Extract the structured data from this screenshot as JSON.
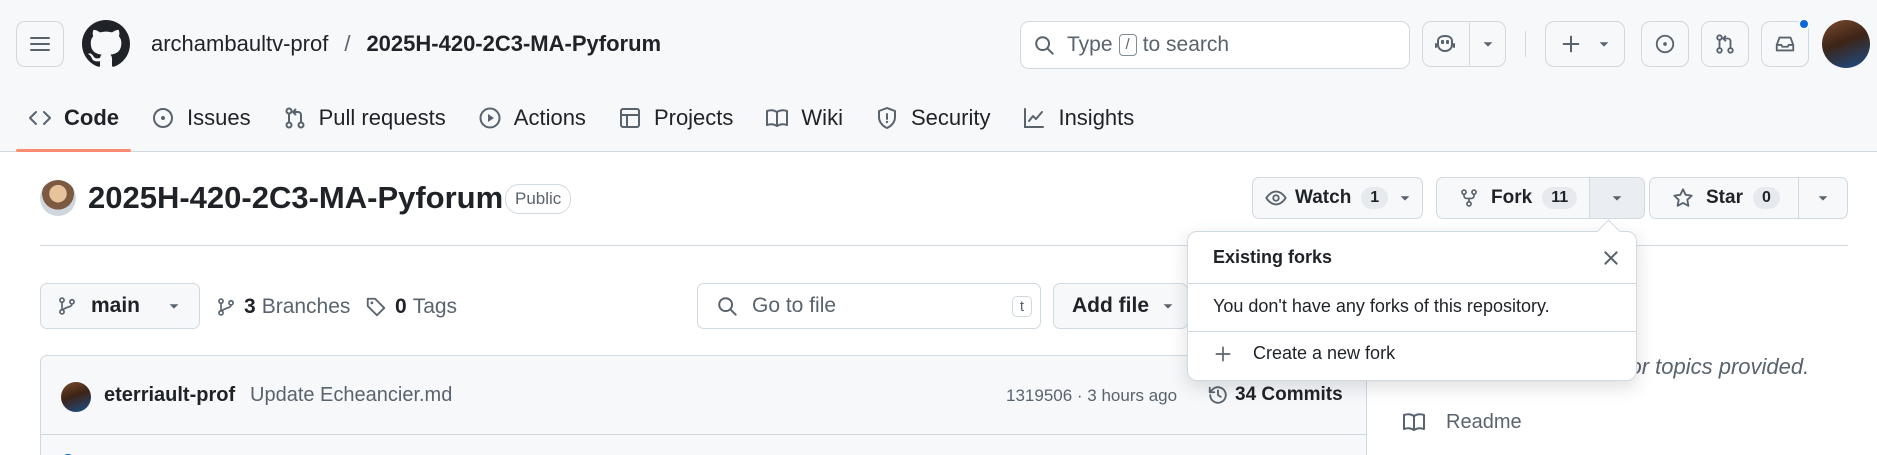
{
  "header": {
    "owner": "archambaultv-prof",
    "separator": "/",
    "repo": "2025H-420-2C3-MA-Pyforum",
    "search": {
      "prefix": "Type",
      "key": "/",
      "suffix": "to search"
    }
  },
  "tabs": [
    {
      "label": "Code",
      "icon": "code-icon",
      "active": true
    },
    {
      "label": "Issues",
      "icon": "issue-icon"
    },
    {
      "label": "Pull requests",
      "icon": "pull-request-icon"
    },
    {
      "label": "Actions",
      "icon": "play-icon"
    },
    {
      "label": "Projects",
      "icon": "table-icon"
    },
    {
      "label": "Wiki",
      "icon": "book-icon"
    },
    {
      "label": "Security",
      "icon": "shield-icon"
    },
    {
      "label": "Insights",
      "icon": "graph-icon"
    }
  ],
  "repo_head": {
    "title": "2025H-420-2C3-MA-Pyforum",
    "visibility": "Public",
    "watch": {
      "label": "Watch",
      "count": "1"
    },
    "fork": {
      "label": "Fork",
      "count": "11"
    },
    "star": {
      "label": "Star",
      "count": "0"
    }
  },
  "file_nav": {
    "branch": "main",
    "branches": {
      "count": "3",
      "label": "Branches"
    },
    "tags": {
      "count": "0",
      "label": "Tags"
    },
    "goto_placeholder": "Go to file",
    "goto_key": "t",
    "add_file": "Add file"
  },
  "latest_commit": {
    "author": "eterriault-prof",
    "message": "Update Echeancier.md",
    "sha_time": "1319506 · 3 hours ago",
    "commits": "34 Commits"
  },
  "about": {
    "text_fragment": "e, or topics provided.",
    "readme": "Readme"
  },
  "fork_popover": {
    "title": "Existing forks",
    "empty": "You don't have any forks of this repository.",
    "create": "Create a new fork"
  },
  "colors": {
    "accent_tab": "#fd8c73",
    "link_blue": "#0969da",
    "border": "#d1d9e0",
    "muted": "#59636e"
  }
}
